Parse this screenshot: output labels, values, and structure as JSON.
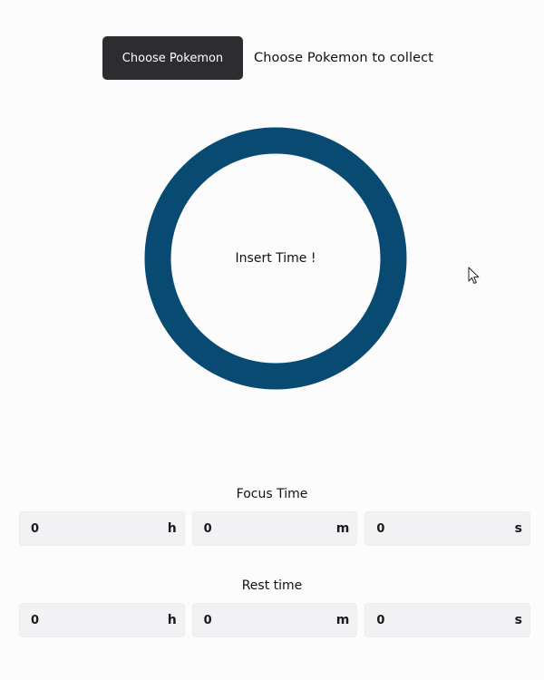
{
  "header": {
    "choose_button_label": "Choose Pokemon",
    "prompt_text": "Choose Pokemon to collect"
  },
  "timer": {
    "label": "Insert Time !",
    "ring_color": "#084a72"
  },
  "focus": {
    "title": "Focus Time",
    "hours": {
      "value": "0",
      "unit": "h"
    },
    "minutes": {
      "value": "0",
      "unit": "m"
    },
    "seconds": {
      "value": "0",
      "unit": "s"
    }
  },
  "rest": {
    "title": "Rest time",
    "hours": {
      "value": "0",
      "unit": "h"
    },
    "minutes": {
      "value": "0",
      "unit": "m"
    },
    "seconds": {
      "value": "0",
      "unit": "s"
    }
  },
  "icons": {
    "cursor": "mouse-pointer-icon"
  }
}
